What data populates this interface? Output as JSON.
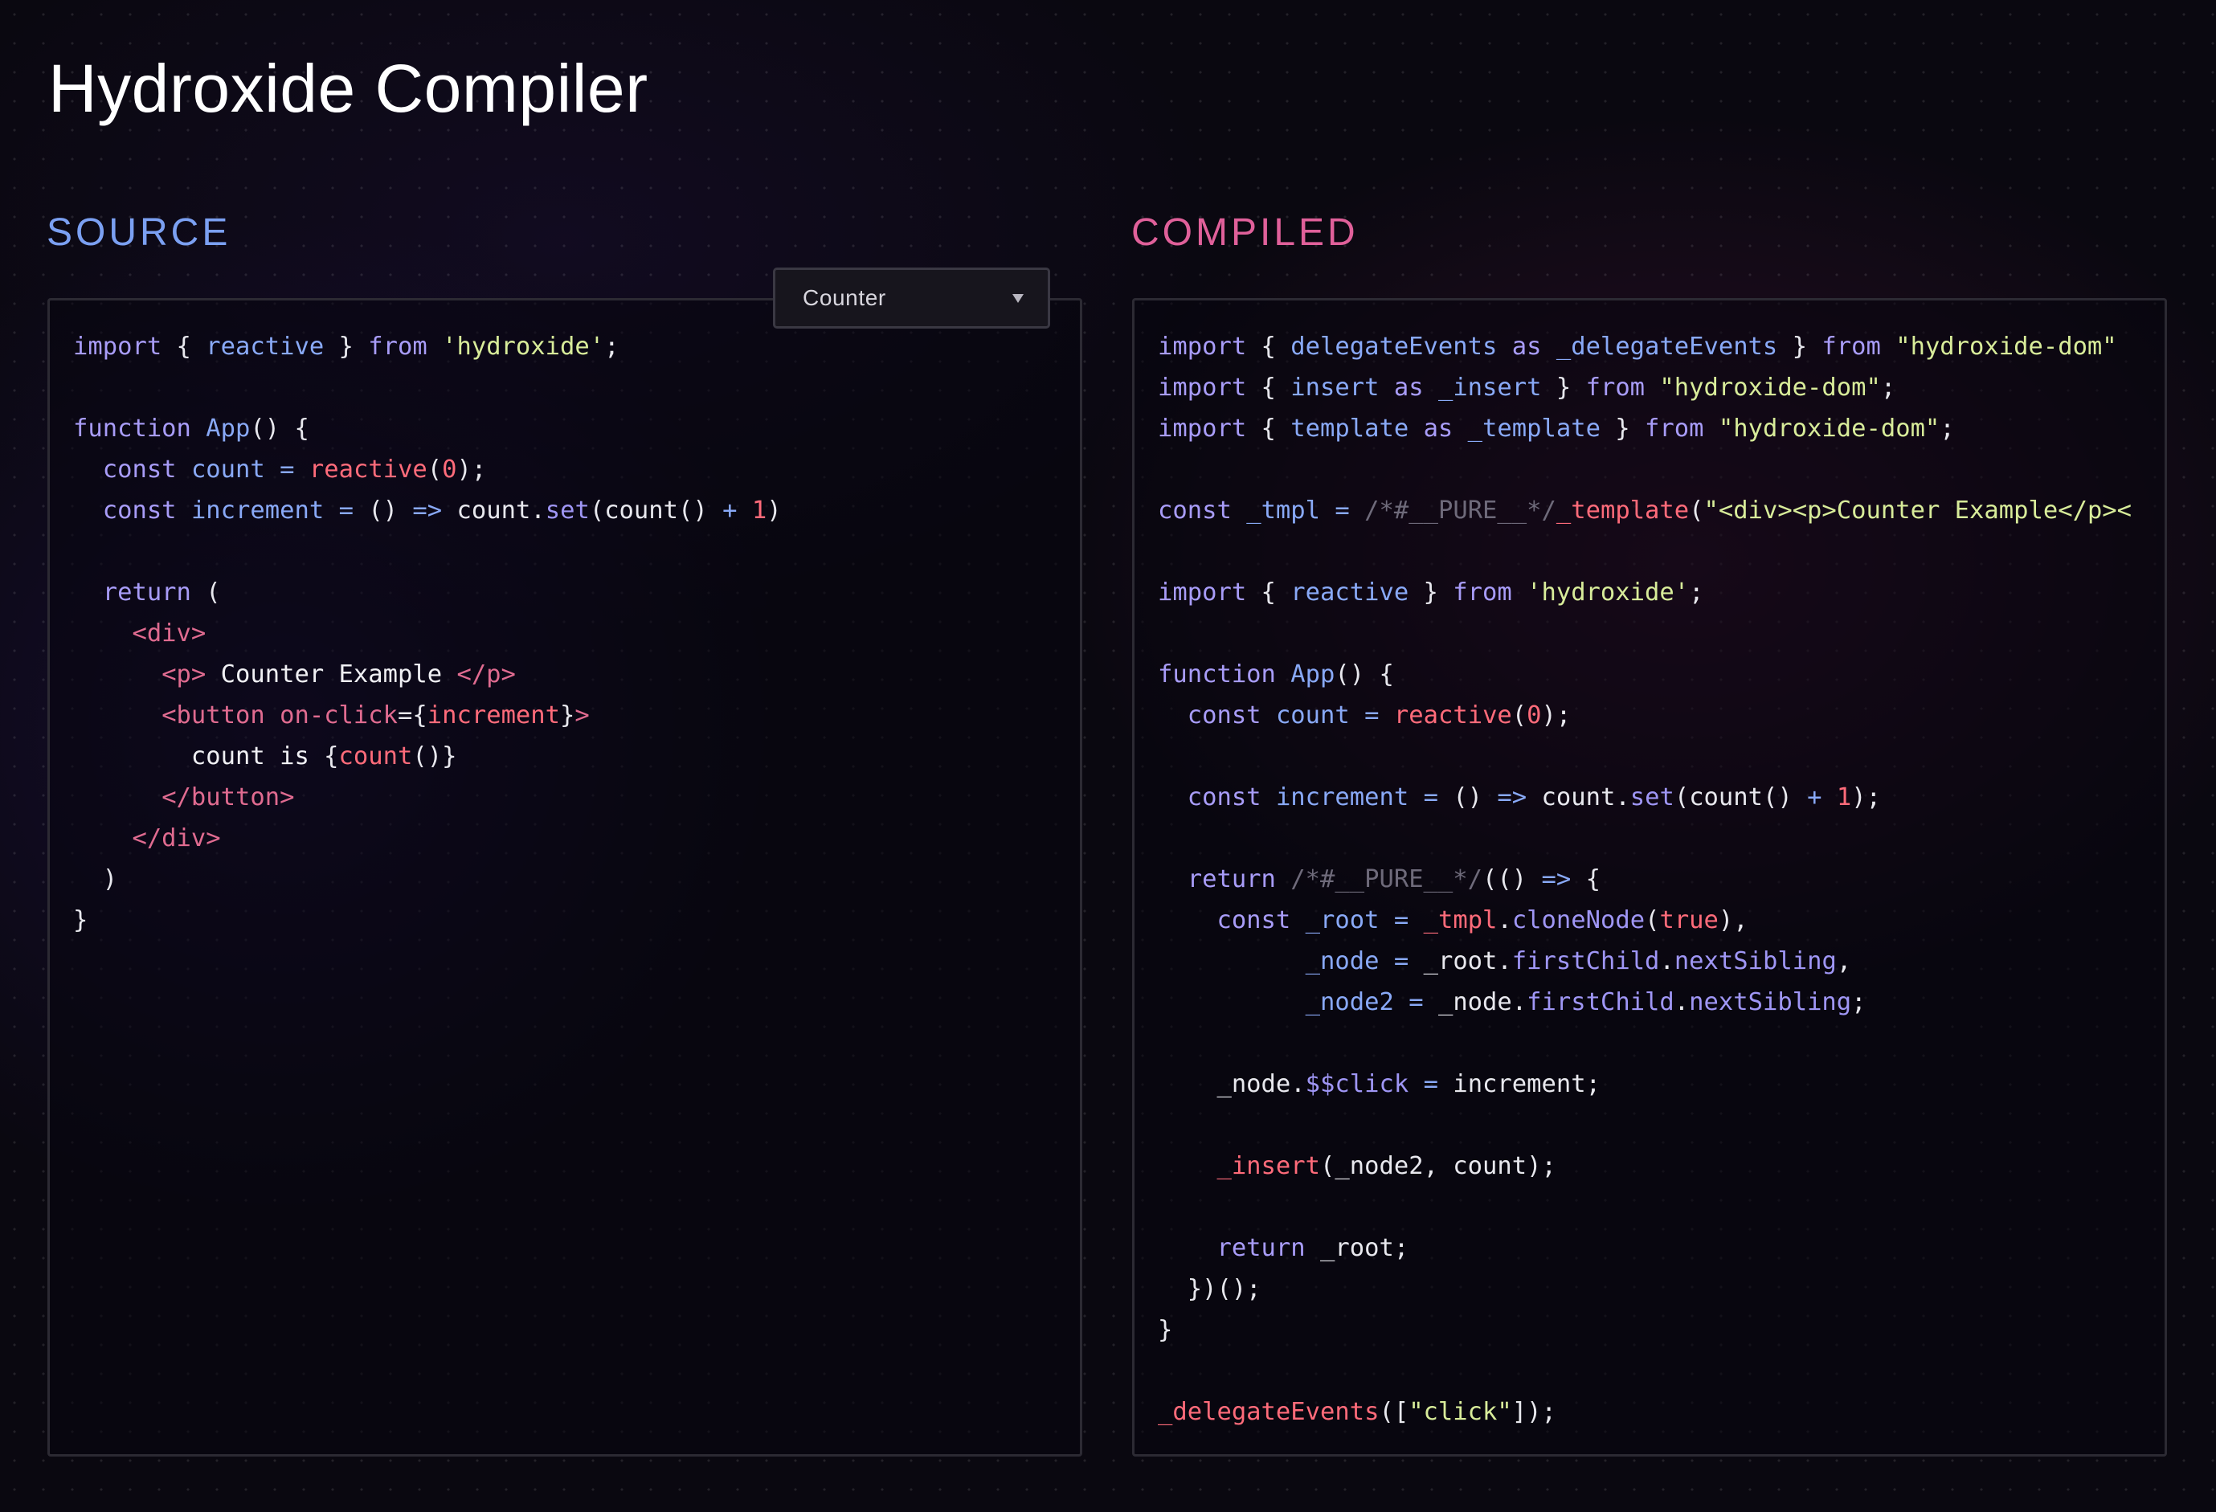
{
  "app": {
    "title": "Hydroxide Compiler"
  },
  "colors": {
    "source_label": "#7ba0f2",
    "compiled_label": "#e0609a",
    "keyword": "#a89cf8",
    "function": "#89a9f7",
    "string": "#d8ec9a",
    "number": "#ff6b7a",
    "tag": "#e06b90",
    "comment": "#6e6a7a"
  },
  "source": {
    "label": "SOURCE",
    "example_select": {
      "selected": "Counter",
      "icon": "chevron-down-icon"
    },
    "lines": [
      [
        [
          "kw",
          "import"
        ],
        [
          "pun",
          " { "
        ],
        [
          "fn",
          "reactive"
        ],
        [
          "pun",
          " } "
        ],
        [
          "kw",
          "from"
        ],
        [
          "pun",
          " "
        ],
        [
          "str",
          "'hydroxide'"
        ],
        [
          "pun",
          ";"
        ]
      ],
      [],
      [
        [
          "kw",
          "function"
        ],
        [
          "pun",
          " "
        ],
        [
          "fn",
          "App"
        ],
        [
          "pun",
          "() {"
        ]
      ],
      [
        [
          "pun",
          "  "
        ],
        [
          "kw",
          "const"
        ],
        [
          "pun",
          " "
        ],
        [
          "fn",
          "count"
        ],
        [
          "pun",
          " "
        ],
        [
          "op",
          "="
        ],
        [
          "pun",
          " "
        ],
        [
          "call",
          "reactive"
        ],
        [
          "pun",
          "("
        ],
        [
          "num",
          "0"
        ],
        [
          "pun",
          ");"
        ]
      ],
      [
        [
          "pun",
          "  "
        ],
        [
          "kw",
          "const"
        ],
        [
          "pun",
          " "
        ],
        [
          "fn",
          "increment"
        ],
        [
          "pun",
          " "
        ],
        [
          "op",
          "="
        ],
        [
          "pun",
          " () "
        ],
        [
          "op",
          "=>"
        ],
        [
          "pun",
          " "
        ],
        [
          "id",
          "count"
        ],
        [
          "pun",
          "."
        ],
        [
          "prop",
          "set"
        ],
        [
          "pun",
          "("
        ],
        [
          "id",
          "count"
        ],
        [
          "pun",
          "() "
        ],
        [
          "op",
          "+"
        ],
        [
          "pun",
          " "
        ],
        [
          "num",
          "1"
        ],
        [
          "pun",
          ")"
        ]
      ],
      [],
      [
        [
          "pun",
          "  "
        ],
        [
          "kw",
          "return"
        ],
        [
          "pun",
          " ("
        ]
      ],
      [
        [
          "pun",
          "    "
        ],
        [
          "tag",
          "<div>"
        ]
      ],
      [
        [
          "pun",
          "      "
        ],
        [
          "tag",
          "<p>"
        ],
        [
          "txt",
          " Counter Example "
        ],
        [
          "tag",
          "</p>"
        ]
      ],
      [
        [
          "pun",
          "      "
        ],
        [
          "tag",
          "<button"
        ],
        [
          "pun",
          " "
        ],
        [
          "attr",
          "on-click"
        ],
        [
          "pun",
          "={"
        ],
        [
          "call",
          "increment"
        ],
        [
          "pun",
          "}"
        ],
        [
          "tag",
          ">"
        ]
      ],
      [
        [
          "pun",
          "        "
        ],
        [
          "txt",
          "count is "
        ],
        [
          "pun",
          "{"
        ],
        [
          "call",
          "count"
        ],
        [
          "pun",
          "()}"
        ]
      ],
      [
        [
          "pun",
          "      "
        ],
        [
          "tag",
          "</button>"
        ]
      ],
      [
        [
          "pun",
          "    "
        ],
        [
          "tag",
          "</div>"
        ]
      ],
      [
        [
          "pun",
          "  )"
        ]
      ],
      [
        [
          "pun",
          "}"
        ]
      ]
    ]
  },
  "compiled": {
    "label": "COMPILED",
    "lines": [
      [
        [
          "kw",
          "import"
        ],
        [
          "pun",
          " { "
        ],
        [
          "fn",
          "delegateEvents"
        ],
        [
          "pun",
          " "
        ],
        [
          "kw",
          "as"
        ],
        [
          "pun",
          " "
        ],
        [
          "fn",
          "_delegateEvents"
        ],
        [
          "pun",
          " } "
        ],
        [
          "kw",
          "from"
        ],
        [
          "pun",
          " "
        ],
        [
          "str",
          "\"hydroxide-dom\""
        ]
      ],
      [
        [
          "kw",
          "import"
        ],
        [
          "pun",
          " { "
        ],
        [
          "fn",
          "insert"
        ],
        [
          "pun",
          " "
        ],
        [
          "kw",
          "as"
        ],
        [
          "pun",
          " "
        ],
        [
          "fn",
          "_insert"
        ],
        [
          "pun",
          " } "
        ],
        [
          "kw",
          "from"
        ],
        [
          "pun",
          " "
        ],
        [
          "str",
          "\"hydroxide-dom\""
        ],
        [
          "pun",
          ";"
        ]
      ],
      [
        [
          "kw",
          "import"
        ],
        [
          "pun",
          " { "
        ],
        [
          "fn",
          "template"
        ],
        [
          "pun",
          " "
        ],
        [
          "kw",
          "as"
        ],
        [
          "pun",
          " "
        ],
        [
          "fn",
          "_template"
        ],
        [
          "pun",
          " } "
        ],
        [
          "kw",
          "from"
        ],
        [
          "pun",
          " "
        ],
        [
          "str",
          "\"hydroxide-dom\""
        ],
        [
          "pun",
          ";"
        ]
      ],
      [],
      [
        [
          "kw",
          "const"
        ],
        [
          "pun",
          " "
        ],
        [
          "fn",
          "_tmpl"
        ],
        [
          "pun",
          " "
        ],
        [
          "op",
          "="
        ],
        [
          "pun",
          " "
        ],
        [
          "cmt",
          "/*#__PURE__*/"
        ],
        [
          "call",
          "_template"
        ],
        [
          "pun",
          "("
        ],
        [
          "str",
          "\"<div><p>Counter Example</p><"
        ]
      ],
      [],
      [
        [
          "kw",
          "import"
        ],
        [
          "pun",
          " { "
        ],
        [
          "fn",
          "reactive"
        ],
        [
          "pun",
          " } "
        ],
        [
          "kw",
          "from"
        ],
        [
          "pun",
          " "
        ],
        [
          "str",
          "'hydroxide'"
        ],
        [
          "pun",
          ";"
        ]
      ],
      [],
      [
        [
          "kw",
          "function"
        ],
        [
          "pun",
          " "
        ],
        [
          "fn",
          "App"
        ],
        [
          "pun",
          "() {"
        ]
      ],
      [
        [
          "pun",
          "  "
        ],
        [
          "kw",
          "const"
        ],
        [
          "pun",
          " "
        ],
        [
          "fn",
          "count"
        ],
        [
          "pun",
          " "
        ],
        [
          "op",
          "="
        ],
        [
          "pun",
          " "
        ],
        [
          "call",
          "reactive"
        ],
        [
          "pun",
          "("
        ],
        [
          "num",
          "0"
        ],
        [
          "pun",
          ");"
        ]
      ],
      [],
      [
        [
          "pun",
          "  "
        ],
        [
          "kw",
          "const"
        ],
        [
          "pun",
          " "
        ],
        [
          "fn",
          "increment"
        ],
        [
          "pun",
          " "
        ],
        [
          "op",
          "="
        ],
        [
          "pun",
          " () "
        ],
        [
          "op",
          "=>"
        ],
        [
          "pun",
          " "
        ],
        [
          "id",
          "count"
        ],
        [
          "pun",
          "."
        ],
        [
          "prop",
          "set"
        ],
        [
          "pun",
          "("
        ],
        [
          "id",
          "count"
        ],
        [
          "pun",
          "() "
        ],
        [
          "op",
          "+"
        ],
        [
          "pun",
          " "
        ],
        [
          "num",
          "1"
        ],
        [
          "pun",
          ");"
        ]
      ],
      [],
      [
        [
          "pun",
          "  "
        ],
        [
          "kw",
          "return"
        ],
        [
          "pun",
          " "
        ],
        [
          "cmt",
          "/*#__PURE__*/"
        ],
        [
          "pun",
          "(() "
        ],
        [
          "op",
          "=>"
        ],
        [
          "pun",
          " {"
        ]
      ],
      [
        [
          "pun",
          "    "
        ],
        [
          "kw",
          "const"
        ],
        [
          "pun",
          " "
        ],
        [
          "fn",
          "_root"
        ],
        [
          "pun",
          " "
        ],
        [
          "op",
          "="
        ],
        [
          "pun",
          " "
        ],
        [
          "call",
          "_tmpl"
        ],
        [
          "pun",
          "."
        ],
        [
          "prop",
          "cloneNode"
        ],
        [
          "pun",
          "("
        ],
        [
          "num",
          "true"
        ],
        [
          "pun",
          "),"
        ]
      ],
      [
        [
          "pun",
          "          "
        ],
        [
          "fn",
          "_node"
        ],
        [
          "pun",
          " "
        ],
        [
          "op",
          "="
        ],
        [
          "pun",
          " "
        ],
        [
          "id",
          "_root"
        ],
        [
          "pun",
          "."
        ],
        [
          "prop",
          "firstChild"
        ],
        [
          "pun",
          "."
        ],
        [
          "prop",
          "nextSibling"
        ],
        [
          "pun",
          ","
        ]
      ],
      [
        [
          "pun",
          "          "
        ],
        [
          "fn",
          "_node2"
        ],
        [
          "pun",
          " "
        ],
        [
          "op",
          "="
        ],
        [
          "pun",
          " "
        ],
        [
          "id",
          "_node"
        ],
        [
          "pun",
          "."
        ],
        [
          "prop",
          "firstChild"
        ],
        [
          "pun",
          "."
        ],
        [
          "prop",
          "nextSibling"
        ],
        [
          "pun",
          ";"
        ]
      ],
      [],
      [
        [
          "pun",
          "    "
        ],
        [
          "id",
          "_node"
        ],
        [
          "pun",
          "."
        ],
        [
          "prop",
          "$$click"
        ],
        [
          "pun",
          " "
        ],
        [
          "op",
          "="
        ],
        [
          "pun",
          " "
        ],
        [
          "id",
          "increment"
        ],
        [
          "pun",
          ";"
        ]
      ],
      [],
      [
        [
          "pun",
          "    "
        ],
        [
          "call",
          "_insert"
        ],
        [
          "pun",
          "("
        ],
        [
          "id",
          "_node2"
        ],
        [
          "pun",
          ", "
        ],
        [
          "id",
          "count"
        ],
        [
          "pun",
          ");"
        ]
      ],
      [],
      [
        [
          "pun",
          "    "
        ],
        [
          "kw",
          "return"
        ],
        [
          "pun",
          " "
        ],
        [
          "id",
          "_root"
        ],
        [
          "pun",
          ";"
        ]
      ],
      [
        [
          "pun",
          "  })();"
        ]
      ],
      [
        [
          "pun",
          "}"
        ]
      ],
      [],
      [
        [
          "call",
          "_delegateEvents"
        ],
        [
          "pun",
          "(["
        ],
        [
          "str",
          "\"click\""
        ],
        [
          "pun",
          "]);"
        ]
      ]
    ]
  }
}
